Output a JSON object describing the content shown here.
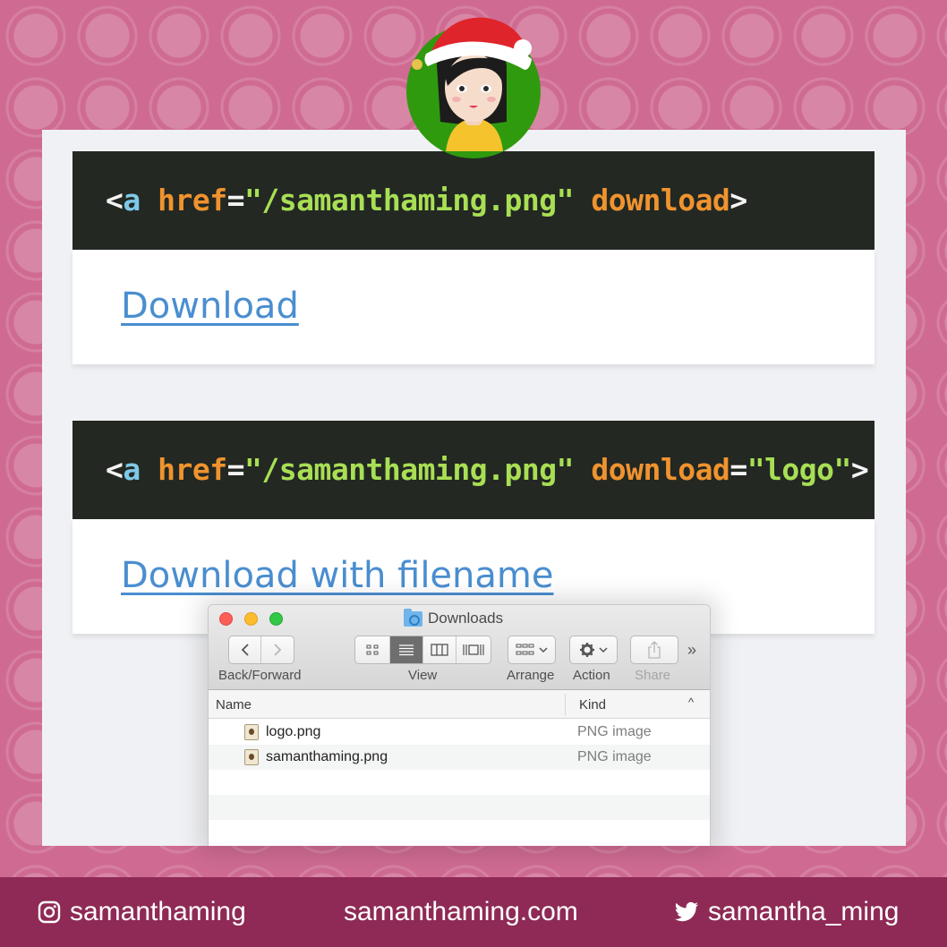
{
  "code_block_1": {
    "lt": "<",
    "tag": "a",
    "attr": "href",
    "eq": "=",
    "value": "\"/samanthaming.png\"",
    "attr2": "download",
    "gt": ">"
  },
  "link_1": {
    "label": "Download"
  },
  "code_block_2": {
    "lt": "<",
    "tag": "a",
    "attr": "href",
    "eq": "=",
    "value": "\"/samanthaming.png\"",
    "attr2": "download",
    "eq2": "=",
    "value2": "\"logo\"",
    "gt": ">"
  },
  "link_2": {
    "label": "Download with filename"
  },
  "finder": {
    "title": "Downloads",
    "toolbar": {
      "back_forward": "Back/Forward",
      "view": "View",
      "arrange": "Arrange",
      "action": "Action",
      "share": "Share",
      "more": "»"
    },
    "columns": {
      "name": "Name",
      "kind": "Kind",
      "sort": "^"
    },
    "files": [
      {
        "name": "logo.png",
        "kind": "PNG image"
      },
      {
        "name": "samanthaming.png",
        "kind": "PNG image"
      }
    ]
  },
  "footer": {
    "instagram": "samanthaming",
    "website": "samanthaming.com",
    "twitter": "samantha_ming"
  },
  "colors": {
    "background_pink": "#cf6b93",
    "footer_bg": "#8e2a55",
    "code_bg": "#232823",
    "link_blue": "#4a8ed0",
    "attr_orange": "#f0932e",
    "string_green": "#a8df54",
    "tag_blue": "#7ec8e8"
  },
  "icons": [
    "santa-avatar",
    "instagram-icon",
    "twitter-icon",
    "folder-icon",
    "gear-icon",
    "share-icon"
  ]
}
